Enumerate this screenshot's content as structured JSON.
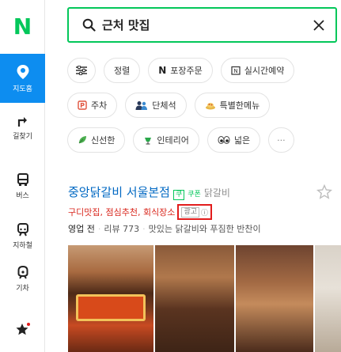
{
  "app": {
    "logo_text": "N"
  },
  "rail": {
    "items": [
      {
        "label": "지도홈",
        "icon": "map-pin-icon"
      },
      {
        "label": "길찾기",
        "icon": "directions-icon"
      },
      {
        "label": "버스",
        "icon": "bus-icon"
      },
      {
        "label": "지하철",
        "icon": "subway-icon"
      },
      {
        "label": "기차",
        "icon": "train-icon"
      },
      {
        "label": "",
        "icon": "favorite-star-icon"
      }
    ]
  },
  "search": {
    "value": "근처 맛집"
  },
  "chips_row1": [
    {
      "label": "",
      "icon": "filter-icon"
    },
    {
      "label": "정렬",
      "icon": ""
    },
    {
      "label": "포장주문",
      "icon": "naver-n-icon"
    },
    {
      "label": "실시간예약",
      "icon": "reservation-icon"
    }
  ],
  "chips_row2": [
    {
      "label": "주차",
      "icon": "parking-icon"
    },
    {
      "label": "단체석",
      "icon": "group-icon"
    },
    {
      "label": "특별한메뉴",
      "icon": "special-menu-icon"
    }
  ],
  "chips_row3": [
    {
      "label": "신선한",
      "icon": "leaf-icon"
    },
    {
      "label": "인테리어",
      "icon": "interior-icon"
    },
    {
      "label": "넓은",
      "icon": "eyes-icon"
    },
    {
      "label": "···",
      "icon": "more-icon"
    }
  ],
  "result": {
    "title": "중앙닭갈비 서울본점",
    "badge_coupon": "쿠",
    "badge_coupon_text": "쿠폰",
    "category": "닭갈비",
    "keywords": "구디맛집, 점심추천, 회식장소",
    "ad_label": "광고",
    "ad_info": "ⓘ",
    "status": "영업 전",
    "review_label": "리뷰 773",
    "review_snippet": "맛있는 닭갈비와 푸짐한 반찬이"
  },
  "colors": {
    "brand": "#03c75a",
    "rail_active": "#0d8df0",
    "title": "#0068c3",
    "keywords": "#d9261c",
    "ad_highlight": "#e21c1c"
  }
}
